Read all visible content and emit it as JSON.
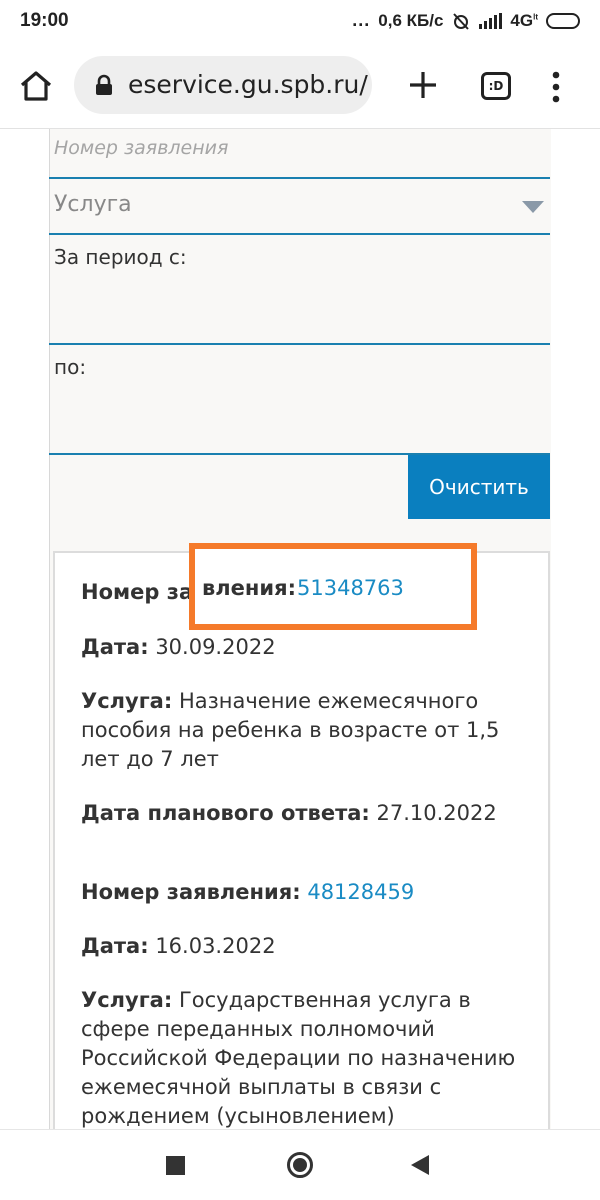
{
  "status_bar": {
    "time": "19:00",
    "dots": "...",
    "speed": "0,6 КБ/с",
    "network": "4G",
    "network_sub": "lt"
  },
  "browser": {
    "url": "eservice.gu.spb.ru/",
    "tab_count_label": ":D"
  },
  "filters": {
    "application_number_placeholder": "Номер заявления",
    "service_label": "Услуга",
    "period_from_label": "За период с:",
    "period_to_label": "по:",
    "clear_button": "Очистить"
  },
  "labels": {
    "number": "Номер заявления:",
    "date": "Дата:",
    "service": "Услуга:",
    "planned_answer": "Дата планового ответа:"
  },
  "applications": [
    {
      "number_label_left": "Номер за",
      "number_label_right": "вления:",
      "number": "51348763",
      "date": "30.09.2022",
      "service": "Назначение ежемесячного пособия на ребенка в возрасте от 1,5 лет до 7 лет",
      "planned_answer": "27.10.2022"
    },
    {
      "number": "48128459",
      "date": "16.03.2022",
      "service": "Государственная услуга в сфере переданных полномочий Российской Федерации по назначению ежемесячной выплаты в связи с рождением (усыновлением)"
    }
  ],
  "colors": {
    "accent": "#0a7fbf",
    "link": "#1a8bc4",
    "highlight": "#f57a2a",
    "field_underline": "#1a80b0"
  }
}
